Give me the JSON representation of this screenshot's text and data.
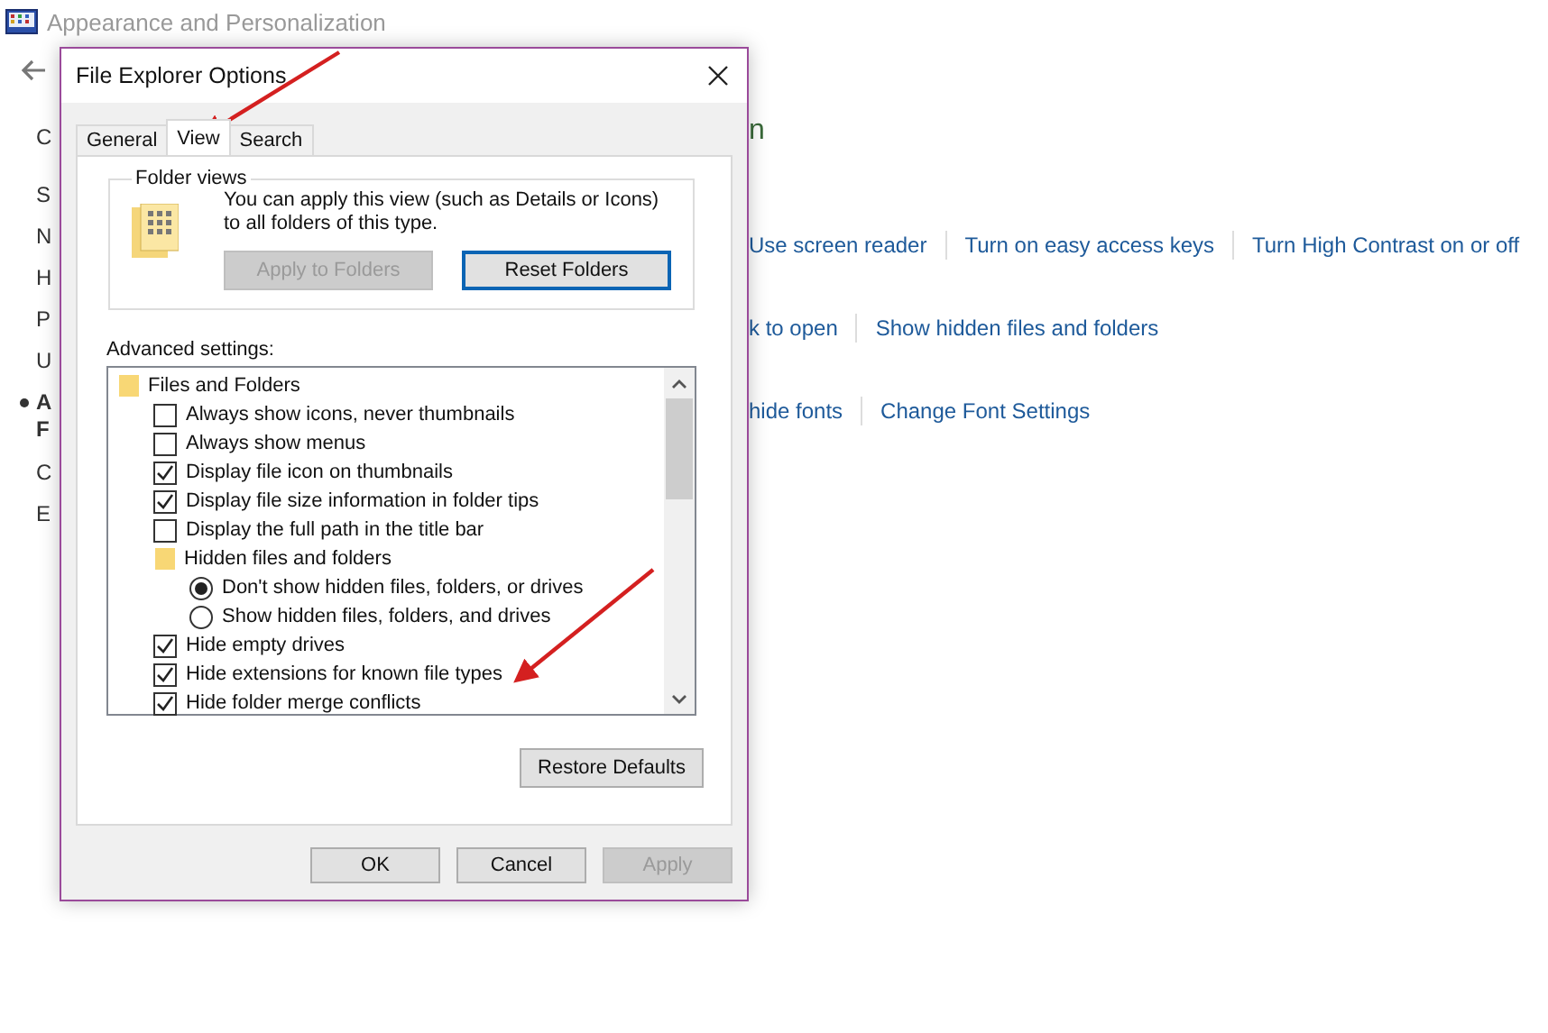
{
  "background": {
    "title": "Appearance and Personalization",
    "left_items": [
      {
        "lines": [
          "C"
        ],
        "current": false
      },
      {
        "lines": [
          "S"
        ],
        "current": false
      },
      {
        "lines": [
          "N"
        ],
        "current": false
      },
      {
        "lines": [
          "H"
        ],
        "current": false
      },
      {
        "lines": [
          "P"
        ],
        "current": false
      },
      {
        "lines": [
          "U"
        ],
        "current": false
      },
      {
        "lines": [
          "A",
          "F"
        ],
        "current": true
      },
      {
        "lines": [
          "C"
        ],
        "current": false
      },
      {
        "lines": [
          "E"
        ],
        "current": false
      }
    ],
    "heading_fragment": "n",
    "link_rows": [
      [
        "Use screen reader",
        "Turn on easy access keys",
        "Turn High Contrast on or off"
      ],
      [
        "k to open",
        "Show hidden files and folders"
      ],
      [
        "hide fonts",
        "Change Font Settings"
      ]
    ]
  },
  "dialog": {
    "title": "File Explorer Options",
    "tabs": [
      {
        "label": "General",
        "selected": false
      },
      {
        "label": "View",
        "selected": true
      },
      {
        "label": "Search",
        "selected": false
      }
    ],
    "folder_views": {
      "legend": "Folder views",
      "text": "You can apply this view (such as Details or Icons) to all folders of this type.",
      "buttons": [
        {
          "label": "Apply to Folders",
          "disabled": true
        },
        {
          "label": "Reset Folders",
          "disabled": false
        }
      ]
    },
    "advanced_label": "Advanced settings:",
    "settings": [
      {
        "kind": "folder",
        "label": "Files and Folders",
        "children": [
          {
            "kind": "checkbox",
            "label": "Always show icons, never thumbnails",
            "checked": false
          },
          {
            "kind": "checkbox",
            "label": "Always show menus",
            "checked": false
          },
          {
            "kind": "checkbox",
            "label": "Display file icon on thumbnails",
            "checked": true
          },
          {
            "kind": "checkbox",
            "label": "Display file size information in folder tips",
            "checked": true
          },
          {
            "kind": "checkbox",
            "label": "Display the full path in the title bar",
            "checked": false
          },
          {
            "kind": "folder",
            "label": "Hidden files and folders",
            "children": [
              {
                "kind": "radio",
                "label": "Don't show hidden files, folders, or drives",
                "selected": true
              },
              {
                "kind": "radio",
                "label": "Show hidden files, folders, and drives",
                "selected": false
              }
            ]
          },
          {
            "kind": "checkbox",
            "label": "Hide empty drives",
            "checked": true
          },
          {
            "kind": "checkbox",
            "label": "Hide extensions for known file types",
            "checked": true
          },
          {
            "kind": "checkbox",
            "label": "Hide folder merge conflicts",
            "checked": true
          }
        ]
      }
    ],
    "restore_button": "Restore Defaults",
    "buttons": [
      {
        "label": "OK",
        "disabled": false
      },
      {
        "label": "Cancel",
        "disabled": false
      },
      {
        "label": "Apply",
        "disabled": true
      }
    ]
  }
}
